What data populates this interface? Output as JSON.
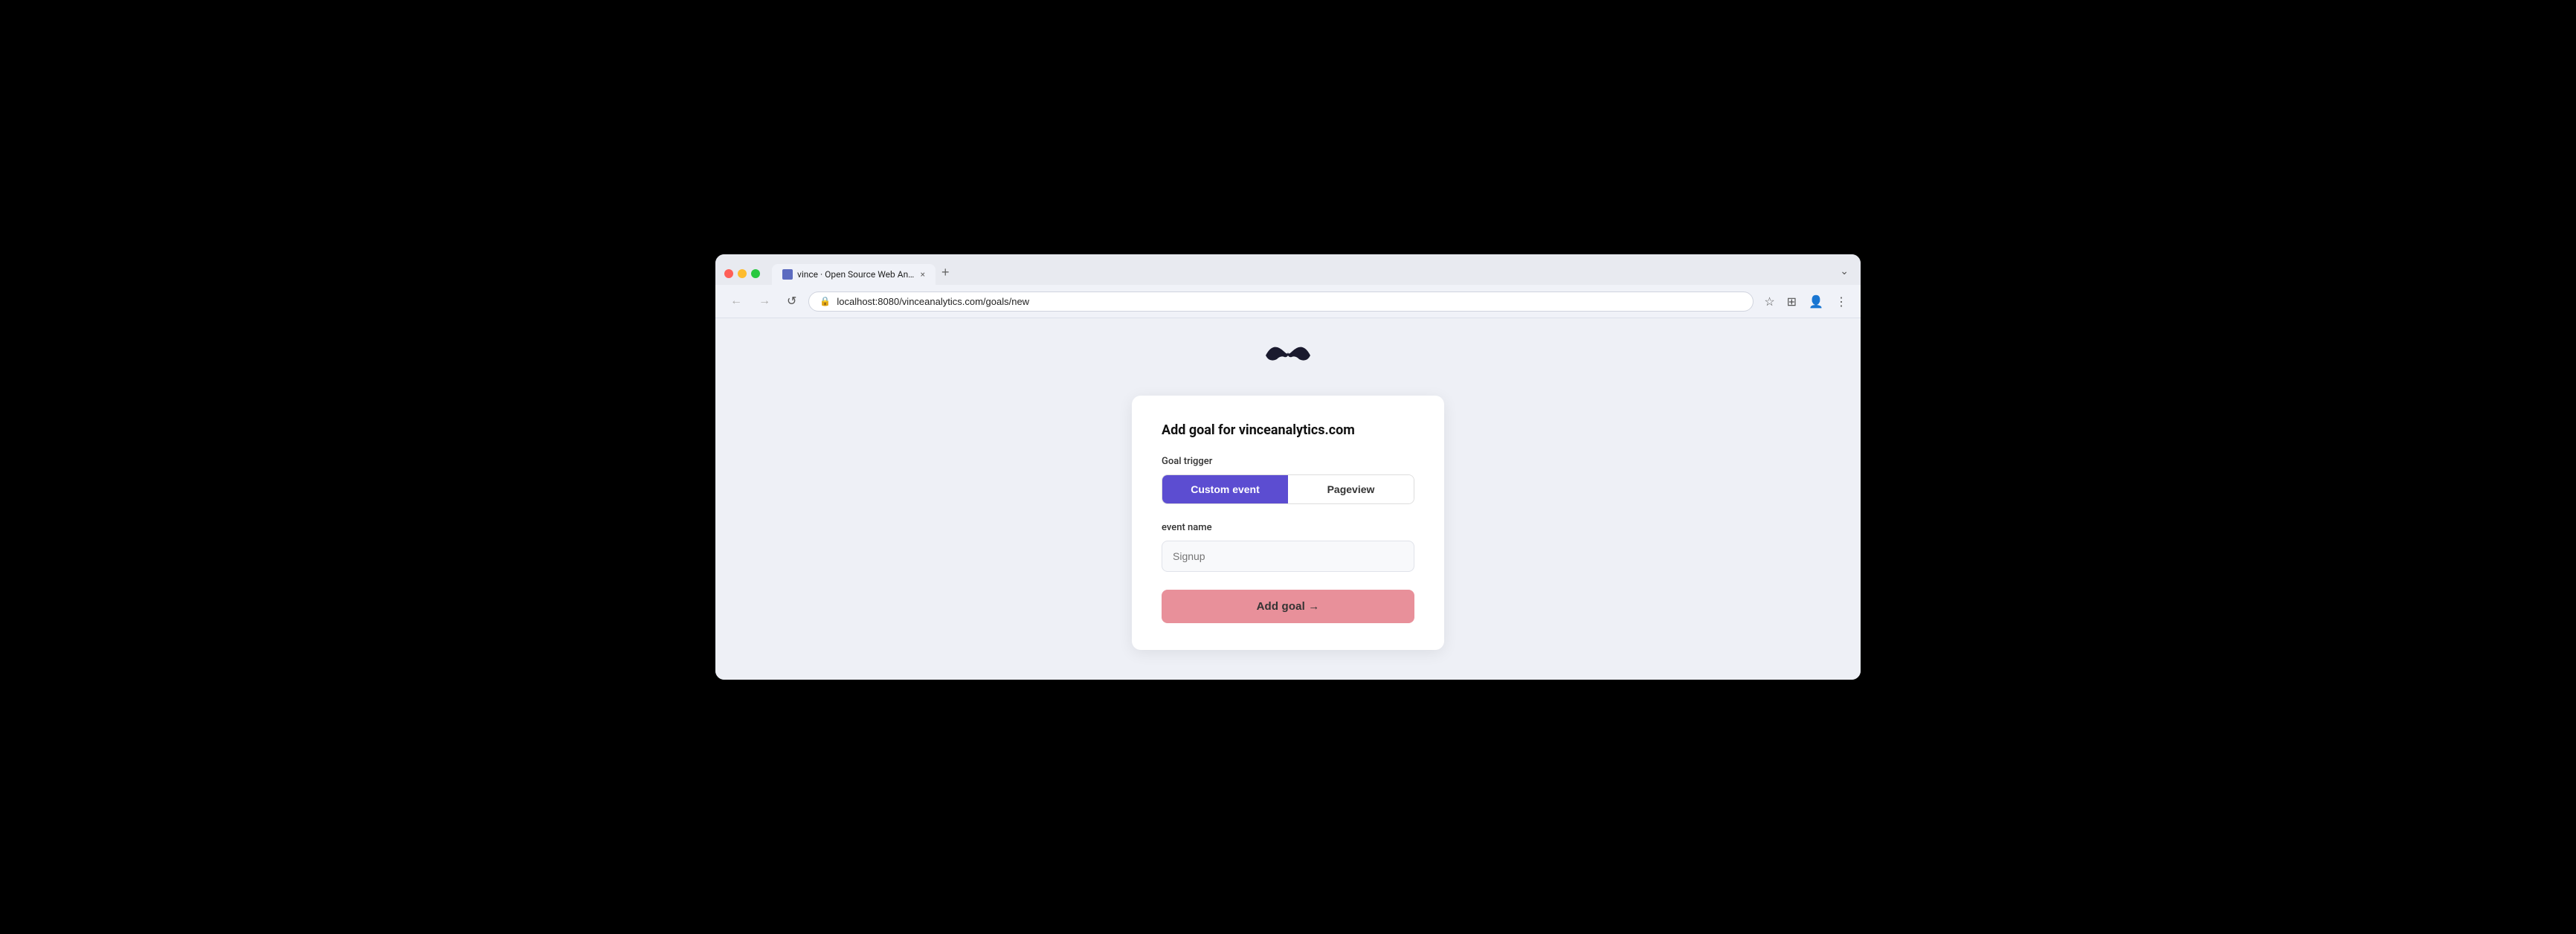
{
  "browser": {
    "tab_title": "vince · Open Source Web Ana…",
    "tab_favicon": "v-icon",
    "tab_close": "×",
    "tab_new": "+",
    "url": "localhost:8080/vinceanalytics.com/goals/new",
    "dropdown_icon": "⌄",
    "back_icon": "←",
    "forward_icon": "→",
    "reload_icon": "↺",
    "star_icon": "☆",
    "extensions_icon": "⊞",
    "profile_icon": "👤",
    "menu_icon": "⋮",
    "lock_icon": "🔒"
  },
  "page": {
    "modal": {
      "title": "Add goal for vinceanalytics.com",
      "goal_trigger_label": "Goal trigger",
      "custom_event_label": "Custom event",
      "pageview_label": "Pageview",
      "event_name_label": "event name",
      "event_name_placeholder": "Signup",
      "submit_label": "Add goal →"
    }
  }
}
